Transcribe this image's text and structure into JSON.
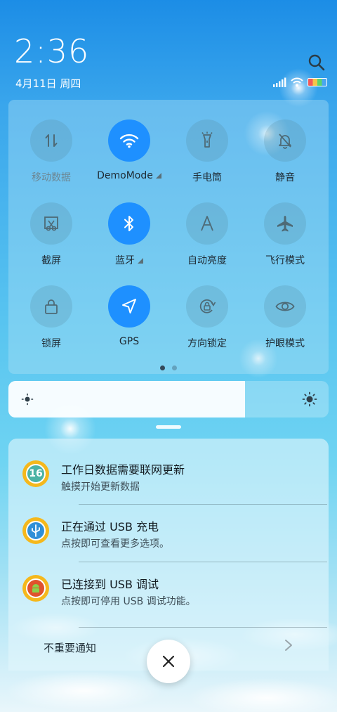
{
  "status": {
    "time": "2:36",
    "date": "4月11日 周四"
  },
  "quick_settings": {
    "tiles": [
      {
        "label": "移动数据",
        "state": "off",
        "icon": "mobile-data-icon"
      },
      {
        "label": "DemoMode",
        "state": "on",
        "icon": "wifi-icon"
      },
      {
        "label": "手电筒",
        "state": "off",
        "icon": "flashlight-icon"
      },
      {
        "label": "静音",
        "state": "off",
        "icon": "bell-mute-icon"
      },
      {
        "label": "截屏",
        "state": "off",
        "icon": "screenshot-icon"
      },
      {
        "label": "蓝牙",
        "state": "on",
        "icon": "bluetooth-icon"
      },
      {
        "label": "自动亮度",
        "state": "off",
        "icon": "auto-brightness-icon"
      },
      {
        "label": "飞行模式",
        "state": "off",
        "icon": "airplane-icon"
      },
      {
        "label": "锁屏",
        "state": "off",
        "icon": "lock-icon"
      },
      {
        "label": "GPS",
        "state": "on",
        "icon": "gps-icon"
      },
      {
        "label": "方向锁定",
        "state": "off",
        "icon": "rotation-lock-icon"
      },
      {
        "label": "护眼模式",
        "state": "off",
        "icon": "eye-icon"
      }
    ],
    "page_indicator": {
      "current": 1,
      "total": 2
    }
  },
  "brightness": {
    "level": 0.74
  },
  "notifications": [
    {
      "title": "工作日数据需要联网更新",
      "body": "触摸开始更新数据",
      "icon": "calendar-16-icon"
    },
    {
      "title": "正在通过 USB 充电",
      "body": "点按即可查看更多选项。",
      "icon": "usb-icon"
    },
    {
      "title": "已连接到 USB 调试",
      "body": "点按即可停用 USB 调试功能。",
      "icon": "android-icon"
    }
  ],
  "footer": {
    "unimportant_label": "不重要通知"
  },
  "colors": {
    "accent": "#1E90FF",
    "tile_off": "#5A8C9E"
  }
}
